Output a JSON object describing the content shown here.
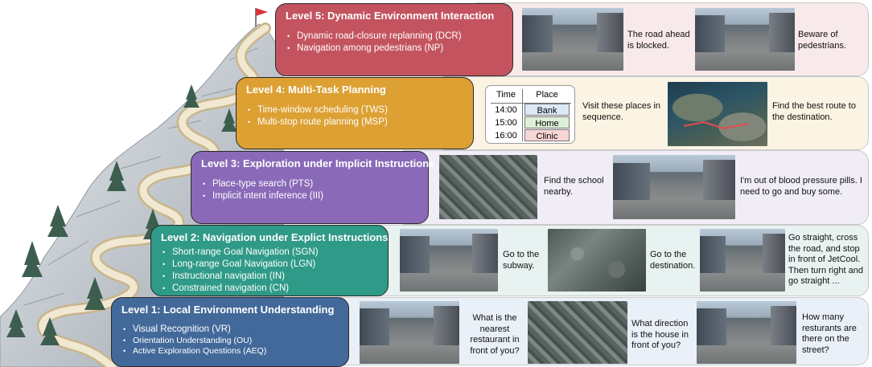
{
  "colors": {
    "level1": "#43699a",
    "level2": "#2f9a87",
    "level3": "#8a6ab8",
    "level4": "#dda033",
    "level5": "#c3545f",
    "panel1": "#eaf0f8",
    "panel2": "#e8f3f1",
    "panel3": "#f1edf7",
    "panel4": "#fbf3e3",
    "panel5": "#f8e9ea",
    "bank": "#dbe8f7",
    "home": "#dff0d8",
    "clinic": "#f8d6d6"
  },
  "levels": [
    {
      "title": "Level 1: Local Environment Understanding",
      "items": [
        "Visual Recognition (VR)",
        "Orientation Understanding (OU)",
        "Active Exploration Questions (AEQ)"
      ],
      "captions": [
        "What is the nearest restaurant in front of you?",
        "What direction is the house in front of you?",
        "How many resturants are there on the street?"
      ]
    },
    {
      "title": "Level 2: Navigation under Explict Instructions",
      "items": [
        "Short-range Goal Navigation (SGN)",
        "Long-range Goal Navigation (LGN)",
        "Instructional navigation (IN)",
        "Constrained navigation (CN)"
      ],
      "captions": [
        "Go to the subway.",
        "Go to the destination.",
        "Go straight, cross the road, and stop in front of JetCool. Then turn right and go straight ..."
      ]
    },
    {
      "title": "Level 3: Exploration under Implicit Instructions",
      "items": [
        "Place-type search (PTS)",
        "Implicit intent inference (III)"
      ],
      "captions": [
        "Find the school nearby.",
        "I'm out of blood pressure pills. I need to go and buy some."
      ]
    },
    {
      "title": "Level 4: Multi-Task Planning",
      "items": [
        "Time-window scheduling (TWS)",
        "Multi-stop route planning (MSP)"
      ],
      "captions": [
        "Visit these places in sequence.",
        "Find the best route to the destination."
      ],
      "schedule": {
        "header_time": "Time",
        "header_place": "Place",
        "rows": [
          {
            "time": "14:00",
            "place": "Bank"
          },
          {
            "time": "15:00",
            "place": "Home"
          },
          {
            "time": "16:00",
            "place": "Clinic"
          }
        ]
      }
    },
    {
      "title": "Level 5: Dynamic Environment Interaction",
      "items": [
        "Dynamic road-closure replanning (DCR)",
        "Navigation among pedestrians (NP)"
      ],
      "captions": [
        "The road ahead is blocked.",
        "Beware of pedestrians."
      ]
    }
  ]
}
